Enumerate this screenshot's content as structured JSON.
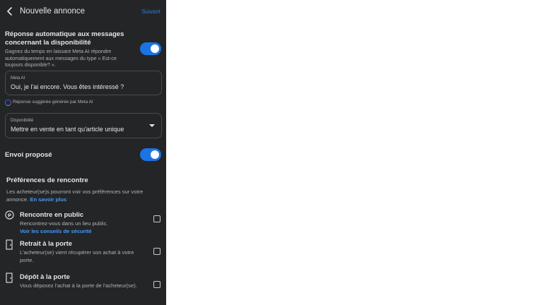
{
  "header": {
    "title": "Nouvelle annonce",
    "next_label": "Suivant"
  },
  "auto_reply": {
    "title": "Réponse automatique aux messages concernant la disponibilité",
    "description": "Gagnez du temps en laissant Meta AI répondre automatiquement aux messages du type « Est-ce toujours disponible? ».",
    "enabled": true
  },
  "meta_ai_field": {
    "label": "Meta AI",
    "value": "Oui, je l'ai encore. Vous êtes intéressé ?"
  },
  "ai_note": "Réponse suggérée générée par Meta AI",
  "availability": {
    "label": "Disponibilité",
    "value": "Mettre en vente en tant qu'article unique"
  },
  "shipping": {
    "label": "Envoi proposé",
    "enabled": true
  },
  "meeting_prefs": {
    "title": "Préférences de rencontre",
    "description": "Les acheteur(se)s pourront voir vos préférences sur votre annonce.",
    "learn_more": "En savoir plus",
    "options": [
      {
        "icon": "public-place-icon",
        "title": "Rencontre en public",
        "description": "Rencontrez-vous dans un lieu public.",
        "link": "Voir les conseils de sécurité",
        "checked": false
      },
      {
        "icon": "door-icon",
        "title": "Retrait à la porte",
        "description": "L'acheteur(se) vient récupérer son achat à votre porte.",
        "checked": false
      },
      {
        "icon": "door-icon",
        "title": "Dépôt à la porte",
        "description": "Vous déposez l'achat à la porte de l'acheteur(se).",
        "checked": false
      }
    ]
  },
  "colors": {
    "background": "#242526",
    "accent": "#1b74e4",
    "link": "#4599ff",
    "text": "#e4e6eb",
    "muted": "#b0b3b8"
  }
}
